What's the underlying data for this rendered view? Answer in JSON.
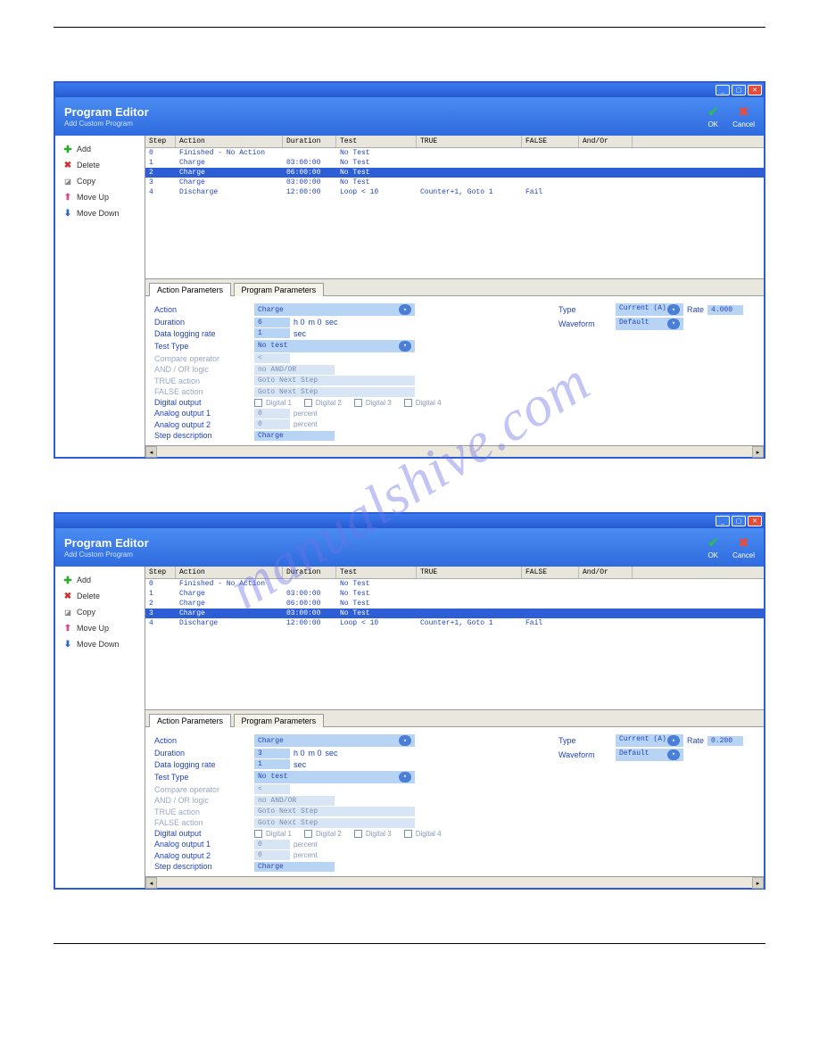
{
  "watermark": "manualshive.com",
  "window_common": {
    "banner_title": "Program Editor",
    "banner_subtitle": "Add Custom Program",
    "ok_label": "OK",
    "cancel_label": "Cancel",
    "sidebar": {
      "add": "Add",
      "delete": "Delete",
      "copy": "Copy",
      "move_up": "Move Up",
      "move_down": "Move Down"
    },
    "grid_headers": {
      "step": "Step",
      "action": "Action",
      "duration": "Duration",
      "test": "Test",
      "true": "TRUE",
      "false": "FALSE",
      "andor": "And/Or"
    },
    "tabs": {
      "action": "Action Parameters",
      "program": "Program Parameters"
    }
  },
  "windows": [
    {
      "selected_row": 2,
      "rows": [
        {
          "step": "0",
          "action": "Finished - No Action",
          "duration": "",
          "test": "No Test",
          "true": "",
          "false": "",
          "andor": ""
        },
        {
          "step": "1",
          "action": "Charge",
          "duration": "03:00:00",
          "test": "No Test",
          "true": "",
          "false": "",
          "andor": ""
        },
        {
          "step": "2",
          "action": "Charge",
          "duration": "06:00:00",
          "test": "No Test",
          "true": "",
          "false": "",
          "andor": ""
        },
        {
          "step": "3",
          "action": "Charge",
          "duration": "03:00:00",
          "test": "No Test",
          "true": "",
          "false": "",
          "andor": ""
        },
        {
          "step": "4",
          "action": "Discharge",
          "duration": "12:00:00",
          "test": "Loop < 10",
          "true": "Counter+1, Goto 1",
          "false": "Fail",
          "andor": ""
        }
      ],
      "params": {
        "action_label": "Action",
        "action_value": "Charge",
        "duration_label": "Duration",
        "duration_h": "6",
        "duration_hu": "h 0",
        "duration_mu": "m 0",
        "duration_s": "sec",
        "log_label": "Data logging rate",
        "log_val": "1",
        "log_unit": "sec",
        "tt_label": "Test Type",
        "tt_value": "No test",
        "cop_label": "Compare operator",
        "cop_value": "<",
        "andor_label": "AND / OR logic",
        "andor_value": "no AND/OR",
        "taction_label": "TRUE action",
        "taction_value": "Goto Next Step",
        "faction_label": "FALSE action",
        "faction_value": "Goto Next Step",
        "dout_label": "Digital output",
        "dout_c1": "Digital 1",
        "dout_c2": "Digital 2",
        "dout_c3": "Digital 3",
        "dout_c4": "Digital 4",
        "ao1_label": "Analog output 1",
        "ao1_val": "0",
        "ao1_unit": "percent",
        "ao2_label": "Analog output 2",
        "ao2_val": "0",
        "ao2_unit": "percent",
        "sdesc_label": "Step description",
        "sdesc_val": "Charge",
        "type_label": "Type",
        "type_value": "Current (A)",
        "rate_label": "Rate",
        "rate_value": "4.000",
        "wave_label": "Waveform",
        "wave_value": "Default"
      }
    },
    {
      "selected_row": 3,
      "rows": [
        {
          "step": "0",
          "action": "Finished - No Action",
          "duration": "",
          "test": "No Test",
          "true": "",
          "false": "",
          "andor": ""
        },
        {
          "step": "1",
          "action": "Charge",
          "duration": "03:00:00",
          "test": "No Test",
          "true": "",
          "false": "",
          "andor": ""
        },
        {
          "step": "2",
          "action": "Charge",
          "duration": "06:00:00",
          "test": "No Test",
          "true": "",
          "false": "",
          "andor": ""
        },
        {
          "step": "3",
          "action": "Charge",
          "duration": "03:00:00",
          "test": "No Test",
          "true": "",
          "false": "",
          "andor": ""
        },
        {
          "step": "4",
          "action": "Discharge",
          "duration": "12:00:00",
          "test": "Loop < 10",
          "true": "Counter+1, Goto 1",
          "false": "Fail",
          "andor": ""
        }
      ],
      "params": {
        "action_label": "Action",
        "action_value": "Charge",
        "duration_label": "Duration",
        "duration_h": "3",
        "duration_hu": "h 0",
        "duration_mu": "m 0",
        "duration_s": "sec",
        "log_label": "Data logging rate",
        "log_val": "1",
        "log_unit": "sec",
        "tt_label": "Test Type",
        "tt_value": "No test",
        "cop_label": "Compare operator",
        "cop_value": "<",
        "andor_label": "AND / OR logic",
        "andor_value": "no AND/OR",
        "taction_label": "TRUE action",
        "taction_value": "Goto Next Step",
        "faction_label": "FALSE action",
        "faction_value": "Goto Next Step",
        "dout_label": "Digital output",
        "dout_c1": "Digital 1",
        "dout_c2": "Digital 2",
        "dout_c3": "Digital 3",
        "dout_c4": "Digital 4",
        "ao1_label": "Analog output 1",
        "ao1_val": "0",
        "ao1_unit": "percent",
        "ao2_label": "Analog output 2",
        "ao2_val": "0",
        "ao2_unit": "percent",
        "sdesc_label": "Step description",
        "sdesc_val": "Charge",
        "type_label": "Type",
        "type_value": "Current (A)",
        "rate_label": "Rate",
        "rate_value": "0.200",
        "wave_label": "Waveform",
        "wave_value": "Default"
      }
    }
  ]
}
